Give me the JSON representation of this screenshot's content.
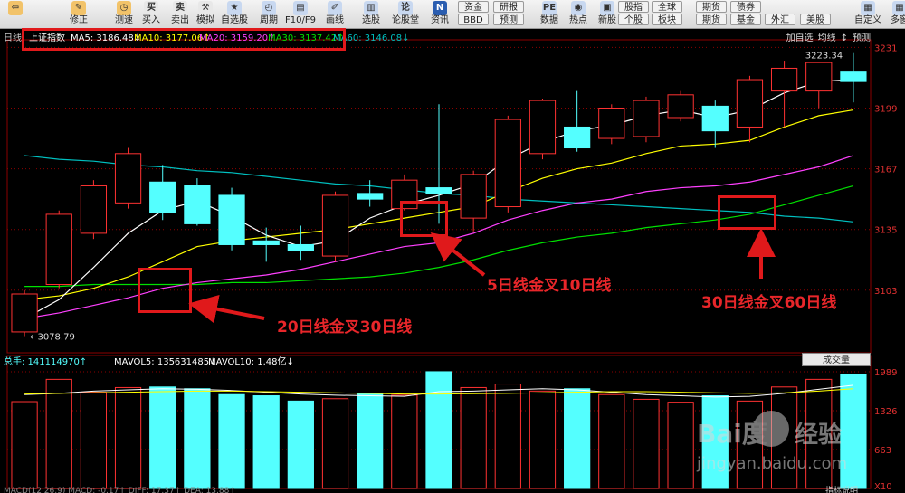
{
  "toolbar": [
    {
      "icon": "back-arrow-icon",
      "label": "",
      "glyph": "⇦",
      "bg": "#f2c36a"
    },
    {
      "icon": "modify-icon",
      "label": "修正",
      "glyph": "✎",
      "bg": "#f2c36a"
    },
    {
      "icon": "clock-icon",
      "label": "测速",
      "glyph": "◷",
      "bg": "#f2c36a"
    },
    {
      "icon": "buy-icon",
      "label": "买入",
      "glyph": "买",
      "bg": "#e8e8e8"
    },
    {
      "icon": "sell-icon",
      "label": "卖出",
      "glyph": "卖",
      "bg": "#e8e8e8"
    },
    {
      "icon": "simulate-icon",
      "label": "模拟",
      "glyph": "⚒",
      "bg": "#e8e8e8"
    },
    {
      "icon": "self-select-icon",
      "label": "自选股",
      "glyph": "★",
      "bg": "#c8d8f0"
    },
    {
      "icon": "period-icon",
      "label": "周期",
      "glyph": "◴",
      "bg": "#c8d8f0"
    },
    {
      "icon": "f10-icon",
      "label": "F10/F9",
      "glyph": "▤",
      "bg": "#c8d8f0"
    },
    {
      "icon": "draw-line-icon",
      "label": "画线",
      "glyph": "✐",
      "bg": "#c8d8f0"
    },
    {
      "icon": "stock-picker-icon",
      "label": "选股",
      "glyph": "▥",
      "bg": "#c8d8f0"
    },
    {
      "icon": "forum-icon",
      "label": "论股堂",
      "glyph": "论",
      "bg": "#c8d8f0"
    },
    {
      "icon": "news-icon",
      "label": "资讯",
      "glyph": "N",
      "bg": "#2a5db0"
    },
    {
      "icon": "data-icon",
      "label": "数据",
      "glyph": "PE",
      "bg": "#c8d8f0"
    },
    {
      "icon": "hot-icon",
      "label": "热点",
      "glyph": "◉",
      "bg": "#c8d8f0"
    },
    {
      "icon": "new-stock-icon",
      "label": "新股",
      "glyph": "▣",
      "bg": "#c8d8f0"
    },
    {
      "icon": "custom-icon",
      "label": "自定义",
      "glyph": "▦",
      "bg": "#c8d8f0"
    },
    {
      "icon": "multi-icon",
      "label": "多窗",
      "glyph": "▦",
      "bg": "#c8d8f0"
    }
  ],
  "toolbar_small": [
    "资金",
    "研报",
    "BBD",
    "预测",
    "股指",
    "全球",
    "期货",
    "债券",
    "个股",
    "板块",
    "期货",
    "基金",
    "外汇",
    "美股"
  ],
  "header": {
    "period": "日线",
    "index_name": "上证指数",
    "ma": [
      {
        "label": "MA5: 3186.48↓",
        "color": "#ffffff"
      },
      {
        "label": "MA10: 3177.06↑",
        "color": "#ffff00"
      },
      {
        "label": "MA20: 3159.20↑",
        "color": "#ff40ff"
      },
      {
        "label": "MA30: 3137.42↑",
        "color": "#00e000"
      },
      {
        "label": "MA60: 3146.08↓",
        "color": "#00c0c0"
      }
    ],
    "buttons": [
      "加自选",
      "均线",
      "↕",
      "预测"
    ]
  },
  "chart_data": {
    "type": "candlestick",
    "ylim": [
      3070,
      3235
    ],
    "y_ticks": [
      3231,
      3199,
      3167,
      3135,
      3103
    ],
    "candles": [
      {
        "o": 3081,
        "h": 3103,
        "l": 3078.79,
        "c": 3101
      },
      {
        "o": 3106,
        "h": 3145,
        "l": 3104,
        "c": 3143
      },
      {
        "o": 3133,
        "h": 3161,
        "l": 3130,
        "c": 3158
      },
      {
        "o": 3149,
        "h": 3178,
        "l": 3146,
        "c": 3175
      },
      {
        "o": 3160,
        "h": 3169,
        "l": 3140,
        "c": 3144
      },
      {
        "o": 3158,
        "h": 3162,
        "l": 3137,
        "c": 3138
      },
      {
        "o": 3153,
        "h": 3157,
        "l": 3124,
        "c": 3127
      },
      {
        "o": 3129,
        "h": 3136,
        "l": 3118,
        "c": 3127
      },
      {
        "o": 3127,
        "h": 3137,
        "l": 3119,
        "c": 3124
      },
      {
        "o": 3121,
        "h": 3155,
        "l": 3118,
        "c": 3153
      },
      {
        "o": 3154,
        "h": 3161,
        "l": 3147,
        "c": 3151
      },
      {
        "o": 3146,
        "h": 3164,
        "l": 3145,
        "c": 3161
      },
      {
        "o": 3157,
        "h": 3201,
        "l": 3138,
        "c": 3154
      },
      {
        "o": 3141,
        "h": 3166,
        "l": 3134,
        "c": 3164
      },
      {
        "o": 3147,
        "h": 3195,
        "l": 3144,
        "c": 3193
      },
      {
        "o": 3175,
        "h": 3204,
        "l": 3172,
        "c": 3203
      },
      {
        "o": 3189,
        "h": 3208,
        "l": 3176,
        "c": 3178
      },
      {
        "o": 3183,
        "h": 3201,
        "l": 3180,
        "c": 3199
      },
      {
        "o": 3184,
        "h": 3205,
        "l": 3181,
        "c": 3203
      },
      {
        "o": 3194,
        "h": 3208,
        "l": 3192,
        "c": 3206
      },
      {
        "o": 3200,
        "h": 3203,
        "l": 3178,
        "c": 3187
      },
      {
        "o": 3189,
        "h": 3216,
        "l": 3181,
        "c": 3214
      },
      {
        "o": 3208,
        "h": 3224,
        "l": 3189,
        "c": 3220
      },
      {
        "o": 3208,
        "h": 3223.34,
        "l": 3199,
        "c": 3223
      },
      {
        "o": 3218,
        "h": 3228,
        "l": 3202,
        "c": 3213
      }
    ],
    "ma5": [
      3088,
      3098,
      3115,
      3133,
      3145,
      3150,
      3142,
      3132,
      3126,
      3129,
      3141,
      3148,
      3153,
      3159,
      3172,
      3181,
      3187,
      3190,
      3195,
      3198,
      3194,
      3198,
      3207,
      3213,
      3214
    ],
    "ma10": [
      3098,
      3100,
      3104,
      3110,
      3118,
      3126,
      3129,
      3131,
      3133,
      3135,
      3138,
      3141,
      3144,
      3147,
      3155,
      3162,
      3167,
      3170,
      3175,
      3179,
      3180,
      3182,
      3189,
      3195,
      3198
    ],
    "ma20": [
      3088,
      3091,
      3095,
      3099,
      3104,
      3107,
      3109,
      3111,
      3114,
      3118,
      3122,
      3126,
      3128,
      3133,
      3140,
      3145,
      3149,
      3151,
      3155,
      3157,
      3158,
      3160,
      3164,
      3168,
      3174
    ],
    "ma30": [
      3105,
      3105,
      3106,
      3106,
      3106,
      3106,
      3107,
      3107,
      3108,
      3109,
      3110,
      3112,
      3115,
      3119,
      3124,
      3128,
      3131,
      3133,
      3136,
      3138,
      3140,
      3143,
      3148,
      3153,
      3158
    ],
    "ma60": [
      3174,
      3172,
      3171,
      3169,
      3168,
      3166,
      3165,
      3163,
      3161,
      3159,
      3158,
      3156,
      3154,
      3153,
      3151,
      3150,
      3149,
      3148,
      3147,
      3146,
      3145,
      3144,
      3142,
      3141,
      3139
    ],
    "high_label": "3223.34",
    "low_label": "3078.79",
    "volume": {
      "ylim": [
        0,
        1989
      ],
      "y_ticks": [
        "1989",
        "1326",
        "663"
      ],
      "unit": "X10",
      "values": [
        1480,
        1860,
        1640,
        1720,
        1730,
        1700,
        1600,
        1580,
        1490,
        1530,
        1620,
        1590,
        1990,
        1720,
        1780,
        1660,
        1700,
        1600,
        1520,
        1470,
        1580,
        1490,
        1730,
        1860,
        1950
      ],
      "mavol5": [
        1600,
        1620,
        1660,
        1680,
        1700,
        1690,
        1670,
        1640,
        1610,
        1590,
        1580,
        1570,
        1650,
        1660,
        1680,
        1700,
        1680,
        1640,
        1600,
        1580,
        1560,
        1570,
        1620,
        1690,
        1760
      ],
      "mavol10": [
        1610,
        1620,
        1630,
        1640,
        1650,
        1660,
        1660,
        1650,
        1640,
        1630,
        1620,
        1610,
        1610,
        1615,
        1620,
        1630,
        1640,
        1650,
        1650,
        1640,
        1630,
        1620,
        1630,
        1660,
        1700
      ]
    }
  },
  "volume_header": {
    "total": "总手: 141114970↑",
    "mavol5": "MAVOL5: 135631485↓",
    "mavol10": "MAVOL10: 1.48亿↓",
    "dropdown": "成交量"
  },
  "bottom_line": {
    "text": "MACD(12,26,9)   MACD: -0.17↑   DIFF: 17.37↑   DEA: 13.88↑",
    "help": "指标说明"
  },
  "annotations": {
    "a1": "20日线金叉30日线",
    "a2": "5日线金叉10日线",
    "a3": "30日线金叉60日线"
  },
  "watermark": {
    "brand": "Bai度",
    "sub": "经验",
    "url": "jingyan.baidu.com"
  },
  "colors": {
    "up": "#ff3232",
    "down": "#54ffff",
    "annotation": "#e0191b",
    "grid": "#8b0000"
  }
}
